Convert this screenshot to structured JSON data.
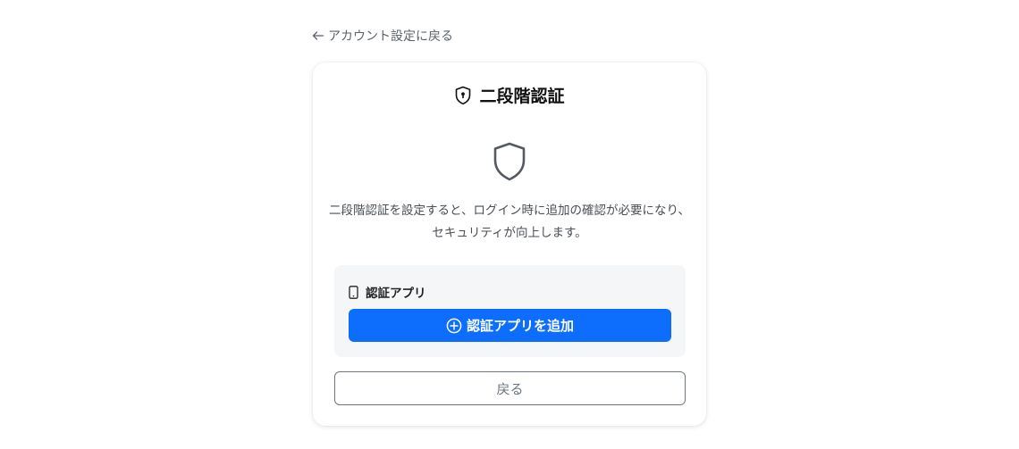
{
  "back_link": {
    "label": "アカウント設定に戻る",
    "icon": "arrow-left-icon"
  },
  "card": {
    "header_icon": "shield-lock-icon",
    "title": "二段階認証",
    "hero_icon": "shield-icon",
    "description": "二段階認証を設定すると、ログイン時に追加の確認が必要になり、セキュリティが向上します。"
  },
  "auth_app": {
    "icon": "phone-icon",
    "label": "認証アプリ",
    "add_button_icon": "plus-circle-icon",
    "add_button_label": "認証アプリを追加"
  },
  "return_button": {
    "label": "戻る"
  },
  "colors": {
    "primary": "#0d6efd",
    "secondary": "#6c757d",
    "panel": "#f5f6f8"
  }
}
